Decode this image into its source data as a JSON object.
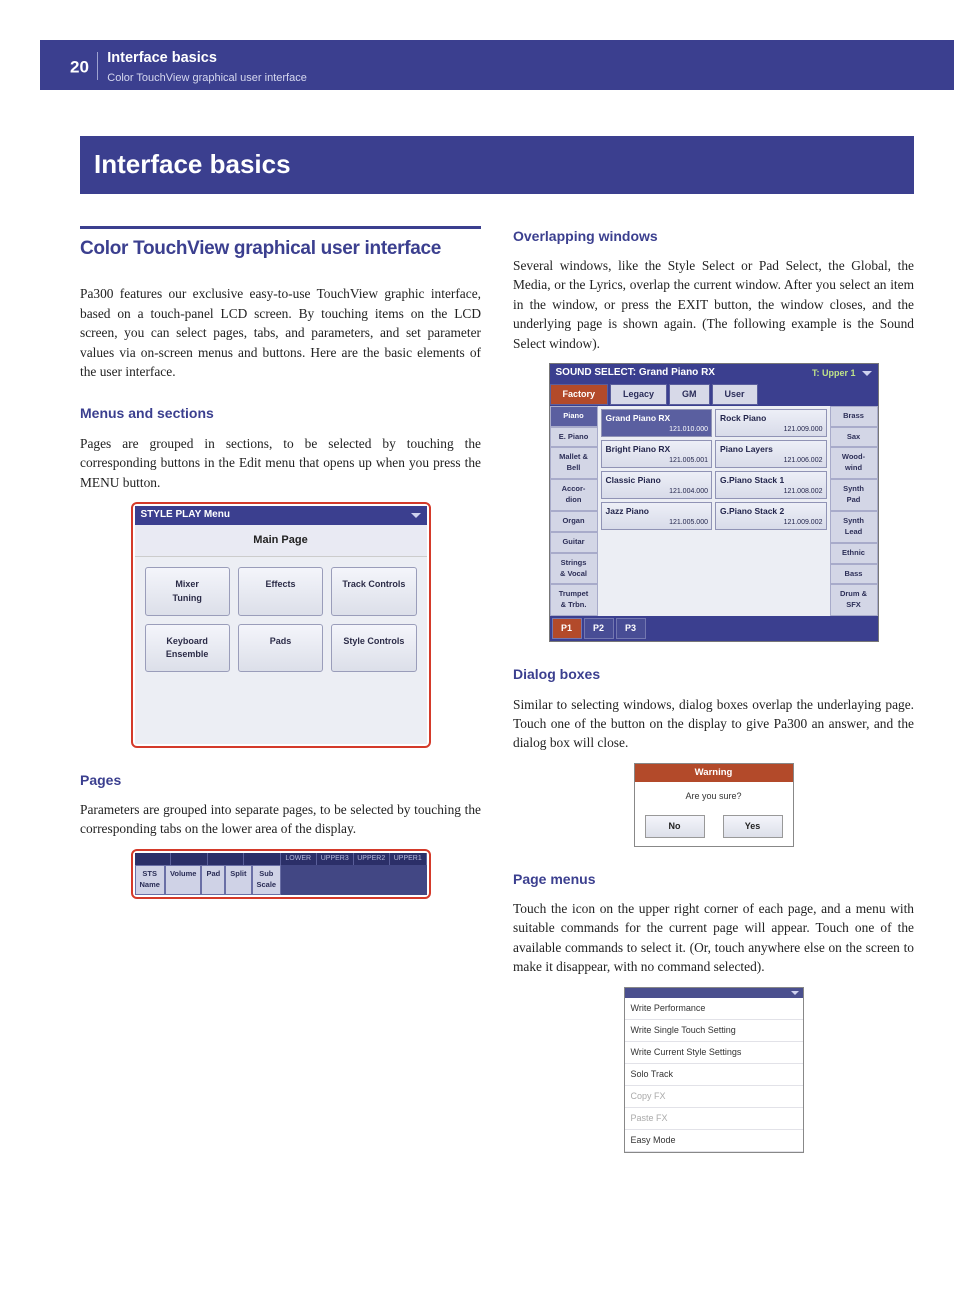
{
  "header": {
    "page_number": "20",
    "crumb_title": "Interface basics",
    "crumb_sub": "Color TouchView graphical user interface"
  },
  "chapter_title": "Interface basics",
  "left": {
    "section_title": "Color TouchView graphical user interface",
    "intro": "Pa300 features our exclusive easy-to-use TouchView graphic interface, based on a touch-panel LCD screen. By touching items on the LCD screen, you can select pages, tabs, and parameters, and set parameter values via on-screen menus and buttons. Here are the basic elements of the user interface.",
    "menus_h": "Menus and sections",
    "menus_p": "Pages are grouped in sections, to be selected by touching the corresponding buttons in the Edit menu that opens up when you press the MENU button.",
    "pages_h": "Pages",
    "pages_p": "Parameters are grouped into separate pages, to be selected by touching the corresponding tabs on the lower area of the display."
  },
  "right": {
    "ow_h": "Overlapping windows",
    "ow_p": "Several windows, like the Style Select or Pad Select, the Global, the Media, or the Lyrics, overlap the current window. After you select an item in the window, or press the EXIT button, the window closes, and the underlying page is shown again. (The following example is the Sound Select window).",
    "db_h": "Dialog boxes",
    "db_p": "Similar to selecting windows, dialog boxes overlap the underlaying page. Touch one of the button on the display to give Pa300 an answer, and the dialog box will close.",
    "pm_h": "Page menus",
    "pm_p": "Touch the icon on the upper right corner of each page, and a menu with suitable commands for the current page will appear. Touch one of the available commands to select it. (Or, touch anywhere else on the screen to make it disappear, with no command selected)."
  },
  "fig_styleplay": {
    "title": "STYLE PLAY Menu",
    "main": "Main Page",
    "cells": [
      "Mixer\nTuning",
      "Effects",
      "Track Controls",
      "Keyboard\nEnsemble",
      "Pads",
      "Style Controls"
    ]
  },
  "fig_tabs": {
    "top": [
      "",
      "",
      "",
      "",
      "LOWER",
      "UPPER3",
      "UPPER2",
      "UPPER1"
    ],
    "bottom": [
      "STS\nName",
      "Volume",
      "Pad",
      "Split",
      "Sub\nScale"
    ]
  },
  "fig_sound": {
    "title": "SOUND SELECT: Grand Piano RX",
    "track": "T: Upper 1",
    "tabs": [
      "Factory",
      "Legacy",
      "GM",
      "User"
    ],
    "left_cats": [
      "Piano",
      "E. Piano",
      "Mallet &\nBell",
      "Accor-\ndion",
      "Organ",
      "Guitar",
      "Strings\n& Vocal",
      "Trumpet\n& Trbn."
    ],
    "right_cats": [
      "Brass",
      "Sax",
      "Wood-\nwind",
      "Synth\nPad",
      "Synth\nLead",
      "Ethnic",
      "Bass",
      "Drum &\nSFX"
    ],
    "items": [
      {
        "n": "Grand Piano RX",
        "v": "121.010.000",
        "sel": true
      },
      {
        "n": "Rock Piano",
        "v": "121.009.000"
      },
      {
        "n": "Bright Piano RX",
        "v": "121.005.001"
      },
      {
        "n": "Piano Layers",
        "v": "121.006.002"
      },
      {
        "n": "Classic Piano",
        "v": "121.004.000"
      },
      {
        "n": "G.Piano Stack 1",
        "v": "121.008.002"
      },
      {
        "n": "Jazz Piano",
        "v": "121.005.000"
      },
      {
        "n": "G.Piano Stack 2",
        "v": "121.009.002"
      }
    ],
    "prow": [
      "P1",
      "P2",
      "P3"
    ],
    "dk": "Drum &\nSFX"
  },
  "fig_dialog": {
    "title": "Warning",
    "msg": "Are you sure?",
    "no": "No",
    "yes": "Yes"
  },
  "fig_pmenu": {
    "items": [
      {
        "t": "Write Performance",
        "d": false
      },
      {
        "t": "Write Single Touch Setting",
        "d": false
      },
      {
        "t": "Write Current Style Settings",
        "d": false
      },
      {
        "t": "Solo Track",
        "d": false
      },
      {
        "t": "Copy FX",
        "d": true
      },
      {
        "t": "Paste FX",
        "d": true
      },
      {
        "t": "Easy Mode",
        "d": false
      }
    ]
  }
}
